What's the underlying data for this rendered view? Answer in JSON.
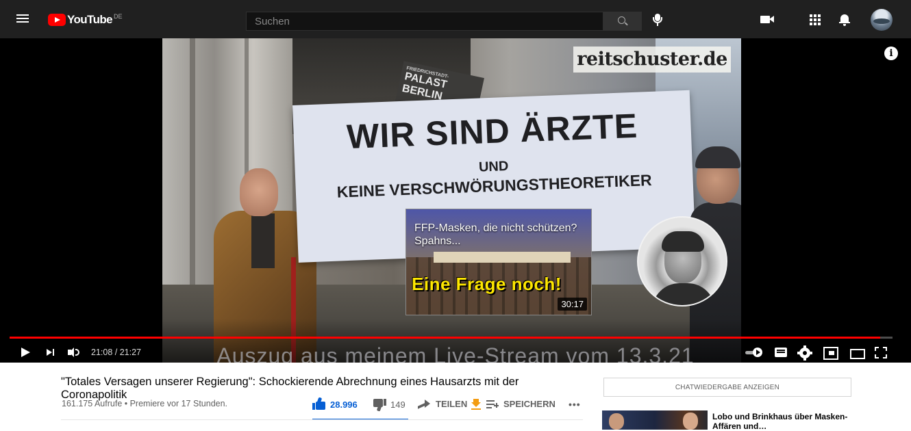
{
  "topbar": {
    "logo_text": "YouTube",
    "country": "DE",
    "search_placeholder": "Suchen",
    "icons": [
      "menu-icon",
      "search-icon",
      "mic-icon",
      "create-video-icon",
      "apps-icon",
      "bell-icon"
    ]
  },
  "player": {
    "video_overlay": {
      "watermark": "reitschuster.de",
      "banner_line1": "WIR SIND ÄRZTE",
      "banner_line2": "UND",
      "banner_line3": "KEINE VERSCHWÖRUNGSTHEORETIKER",
      "sign_small": "FRIEDRICHSTADT-",
      "sign_text": "PALAST BERLIN",
      "subtitle": "Auszug aus meinem Live-Stream vom 13.3.21"
    },
    "endcard": {
      "title": "FFP-Masken, die nicht schützen? Spahns...",
      "big_text": "Eine Frage noch!",
      "duration": "30:17"
    },
    "info_label": "i",
    "time": "21:08 / 21:27",
    "progress": 0.9859,
    "colors": {
      "progress": "#ff0000",
      "accent": "#065fd4"
    }
  },
  "video": {
    "title": "\"Totales Versagen unserer Regierung\": Schockierende Abrechnung eines Hausarzts mit der Coronapolitik",
    "meta": "161.175 Aufrufe • Premiere vor 17 Stunden.",
    "likes": "28.996",
    "dislikes": "149",
    "share_label": "TEILEN",
    "save_label": "SPEICHERN",
    "more_label": "•••"
  },
  "sidebar": {
    "chat_replay_label": "CHATWIEDERGABE ANZEIGEN",
    "recommendation": {
      "title": "Lobo und Brinkhaus über Masken-Affären und…"
    }
  }
}
